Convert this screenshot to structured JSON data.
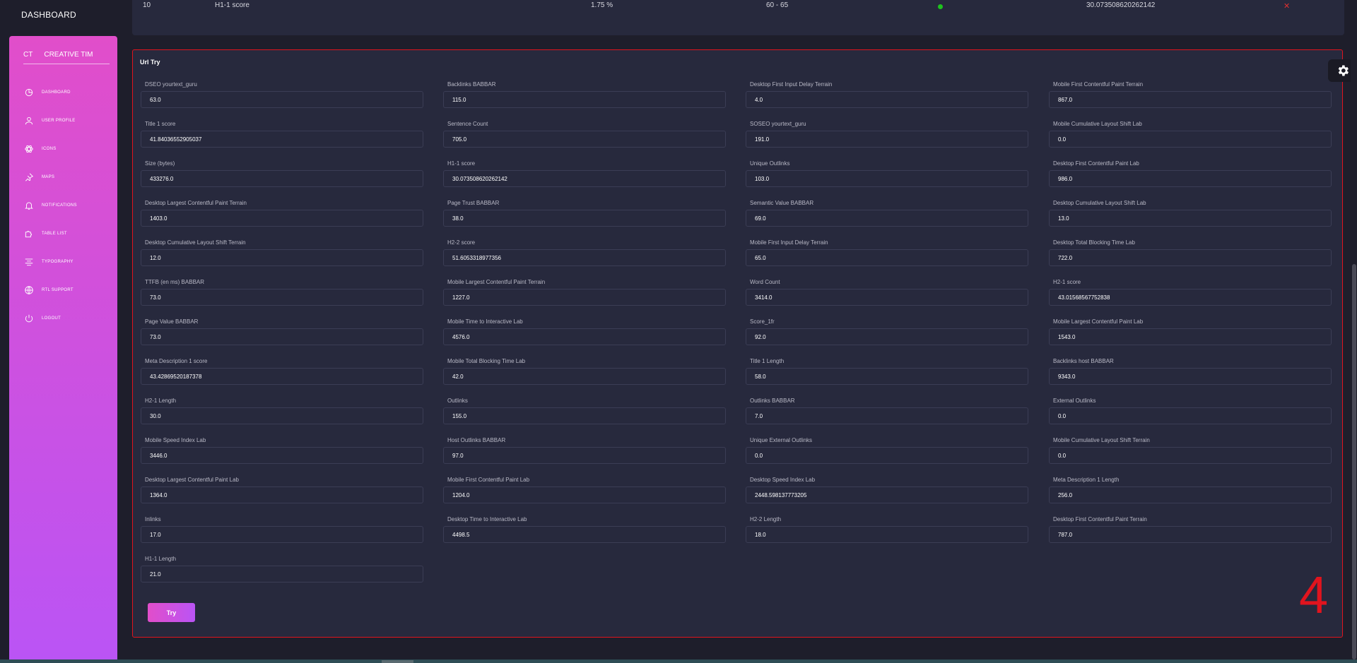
{
  "topnav": {
    "title": "DASHBOARD"
  },
  "sidebar": {
    "logo_mini": "CT",
    "logo_text": "CREATIVE TIM",
    "items": [
      {
        "label": "DASHBOARD",
        "icon": "chart-pie-icon"
      },
      {
        "label": "USER PROFILE",
        "icon": "user-icon"
      },
      {
        "label": "ICONS",
        "icon": "atom-icon"
      },
      {
        "label": "MAPS",
        "icon": "pin-icon"
      },
      {
        "label": "NOTIFICATIONS",
        "icon": "bell-icon"
      },
      {
        "label": "TABLE LIST",
        "icon": "puzzle-icon"
      },
      {
        "label": "TYPOGRAPHY",
        "icon": "align-center-icon"
      },
      {
        "label": "RTL SUPPORT",
        "icon": "world-icon"
      },
      {
        "label": "LOGOUT",
        "icon": "power-icon"
      }
    ]
  },
  "top_row": {
    "index": "10",
    "name": "H1-1 score",
    "percent": "1.75 %",
    "range": "60 - 65",
    "status_color": "#1ec21e",
    "value": "30.073508620262142",
    "action_icon": "close-icon"
  },
  "card": {
    "title": "Url Try",
    "try_label": "Try",
    "annotation": "4",
    "fields": [
      [
        "DSEO yourtext_guru",
        "63.0"
      ],
      [
        "Backlinks BABBAR",
        "115.0"
      ],
      [
        "Desktop First Input Delay Terrain",
        "4.0"
      ],
      [
        "Mobile First Contentful Paint Terrain",
        "867.0"
      ],
      [
        "Title 1 score",
        "41.84036552905037"
      ],
      [
        "Sentence Count",
        "705.0"
      ],
      [
        "SOSEO yourtext_guru",
        "191.0"
      ],
      [
        "Mobile Cumulative Layout Shift Lab",
        "0.0"
      ],
      [
        "Size (bytes)",
        "433276.0"
      ],
      [
        "H1-1 score",
        "30.073508620262142"
      ],
      [
        "Unique Outlinks",
        "103.0"
      ],
      [
        "Desktop First Contentful Paint Lab",
        "986.0"
      ],
      [
        "Desktop Largest Contentful Paint Terrain",
        "1403.0"
      ],
      [
        "Page Trust BABBAR",
        "38.0"
      ],
      [
        "Semantic Value BABBAR",
        "69.0"
      ],
      [
        "Desktop Cumulative Layout Shift Lab",
        "13.0"
      ],
      [
        "Desktop Cumulative Layout Shift Terrain",
        "12.0"
      ],
      [
        "H2-2 score",
        "51.6053318977356"
      ],
      [
        "Mobile First Input Delay Terrain",
        "65.0"
      ],
      [
        "Desktop Total Blocking Time Lab",
        "722.0"
      ],
      [
        "TTFB (en ms) BABBAR",
        "73.0"
      ],
      [
        "Mobile Largest Contentful Paint Terrain",
        "1227.0"
      ],
      [
        "Word Count",
        "3414.0"
      ],
      [
        "H2-1 score",
        "43.01568567752838"
      ],
      [
        "Page Value BABBAR",
        "73.0"
      ],
      [
        "Mobile Time to Interactive Lab",
        "4576.0"
      ],
      [
        "Score_1fr",
        "92.0"
      ],
      [
        "Mobile Largest Contentful Paint Lab",
        "1543.0"
      ],
      [
        "Meta Description 1 score",
        "43.42869520187378"
      ],
      [
        "Mobile Total Blocking Time Lab",
        "42.0"
      ],
      [
        "Title 1 Length",
        "58.0"
      ],
      [
        "Backlinks host BABBAR",
        "9343.0"
      ],
      [
        "H2-1 Length",
        "30.0"
      ],
      [
        "Outlinks",
        "155.0"
      ],
      [
        "Outlinks BABBAR",
        "7.0"
      ],
      [
        "External Outlinks",
        "0.0"
      ],
      [
        "Mobile Speed Index Lab",
        "3446.0"
      ],
      [
        "Host Outlinks BABBAR",
        "97.0"
      ],
      [
        "Unique External Outlinks",
        "0.0"
      ],
      [
        "Mobile Cumulative Layout Shift Terrain",
        "0.0"
      ],
      [
        "Desktop Largest Contentful Paint Lab",
        "1364.0"
      ],
      [
        "Mobile First Contentful Paint Lab",
        "1204.0"
      ],
      [
        "Desktop Speed Index Lab",
        "2448.598137773205"
      ],
      [
        "Meta Description 1 Length",
        "256.0"
      ],
      [
        "Inlinks",
        "17.0"
      ],
      [
        "Desktop Time to Interactive Lab",
        "4498.5"
      ],
      [
        "H2-2 Length",
        "18.0"
      ],
      [
        "Desktop First Contentful Paint Terrain",
        "787.0"
      ],
      [
        "H1-1 Length",
        "21.0"
      ]
    ]
  },
  "settings_icon": "gear-icon",
  "colors": {
    "accent_start": "#e14eca",
    "accent_end": "#ba54f5",
    "card_border": "#e0141e"
  }
}
